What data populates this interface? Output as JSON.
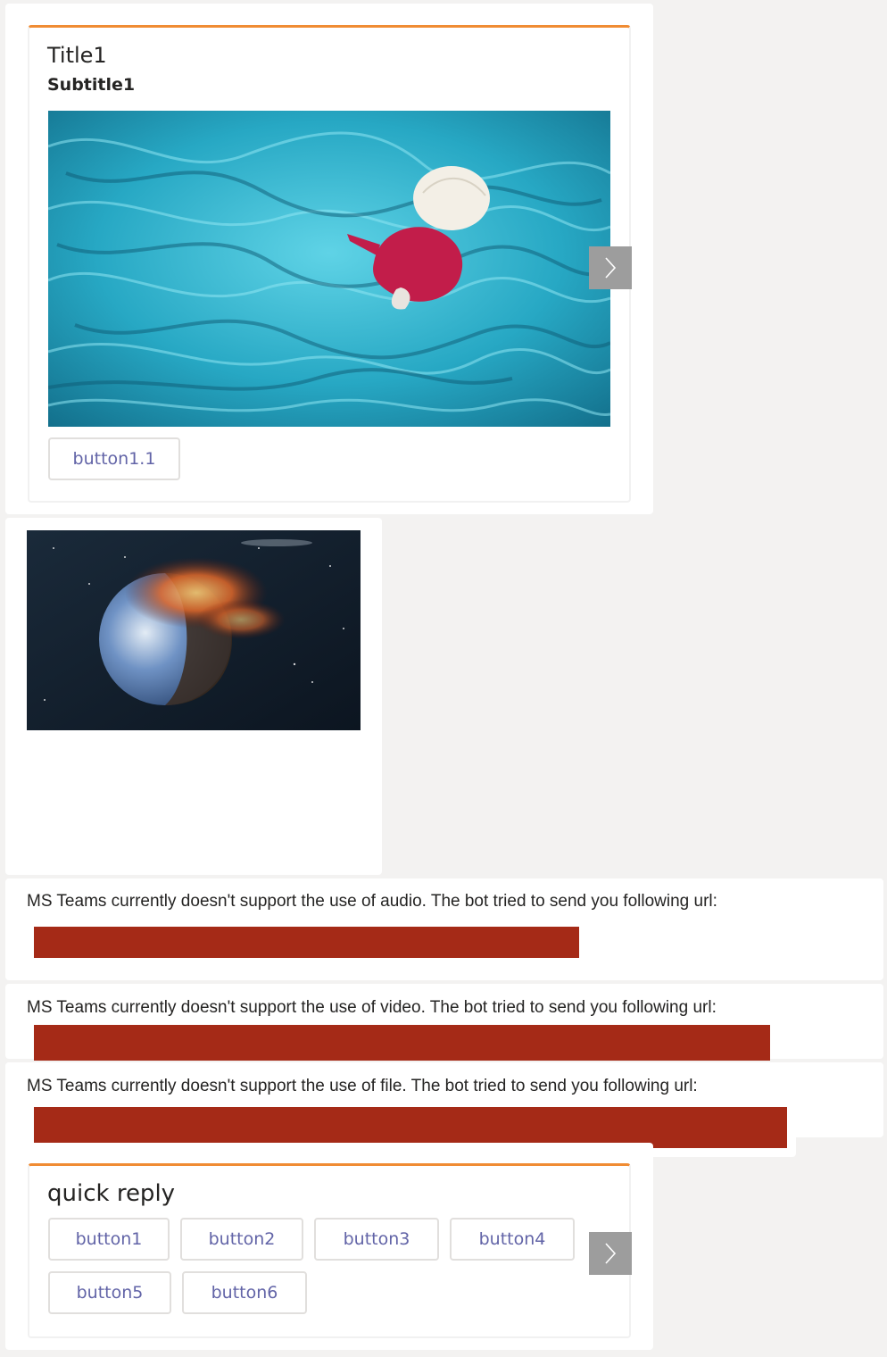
{
  "hero_card": {
    "title": "Title1",
    "subtitle": "Subtitle1",
    "image_icon": "photo-woman-blue-fabric",
    "button": "button1.1",
    "next_icon": "chevron-right-icon"
  },
  "image_message": {
    "image_icon": "photo-planet-collision"
  },
  "notices": {
    "audio": "MS Teams currently doesn't support the use of audio. The bot tried to send you following url:",
    "video": "MS Teams currently doesn't support the use of video. The bot tried to send you following url:",
    "file": "MS Teams currently doesn't support the use of file. The bot tried to send you following url:"
  },
  "quick_reply": {
    "title": "quick reply",
    "buttons": [
      "button1",
      "button2",
      "button3",
      "button4",
      "button5",
      "button6"
    ],
    "next_icon": "chevron-right-icon"
  },
  "colors": {
    "accent": "#f08c33",
    "button_text": "#6264a7",
    "redacted": "#a52a17",
    "background": "#f3f2f1"
  }
}
